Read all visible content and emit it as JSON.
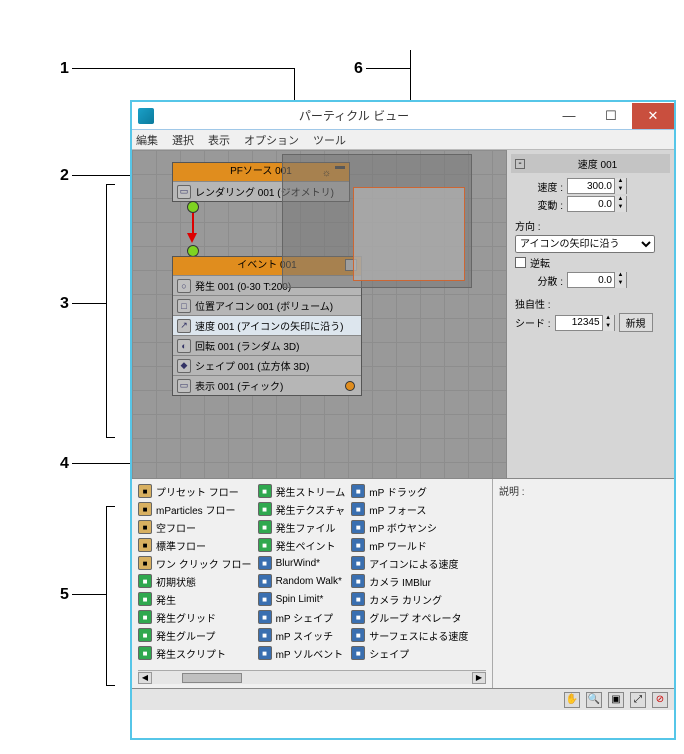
{
  "callouts": {
    "1": "1",
    "2": "2",
    "3": "3",
    "4": "4",
    "5": "5",
    "6": "6"
  },
  "window": {
    "title": "パーティクル ビュー",
    "menu": [
      "編集",
      "選択",
      "表示",
      "オプション",
      "ツール"
    ]
  },
  "pf_source": {
    "title": "PFソース 001",
    "render": "レンダリング 001 (ジオメトリ)"
  },
  "event1": {
    "title": "イベント 001",
    "ops": [
      {
        "icon": "○",
        "label": "発生 001 (0-30 T:200)"
      },
      {
        "icon": "□",
        "label": "位置アイコン 001 (ボリューム)"
      },
      {
        "icon": "↗",
        "label": "速度 001 (アイコンの矢印に沿う)"
      },
      {
        "icon": "◐",
        "label": "回転 001 (ランダム 3D)"
      },
      {
        "icon": "◆",
        "label": "シェイプ 001 (立方体 3D)"
      },
      {
        "icon": "▭",
        "label": "表示 001 (ティック)"
      }
    ]
  },
  "props": {
    "title": "速度 001",
    "speed_label": "速度 :",
    "speed": "300.0",
    "var_label": "変動 :",
    "var": "0.0",
    "dir_label": "方向 :",
    "dir_value": "アイコンの矢印に沿う",
    "rev_label": "逆転",
    "div_label": "分散 :",
    "div": "0.0",
    "uniq_label": "独自性 :",
    "seed_label": "シード :",
    "seed": "12345",
    "new_btn": "新規"
  },
  "depot": {
    "desc_label": "説明 :",
    "col1": [
      {
        "c": "di-brown",
        "t": "プリセット フロー"
      },
      {
        "c": "di-brown",
        "t": "mParticles フロー"
      },
      {
        "c": "di-brown",
        "t": "空フロー"
      },
      {
        "c": "di-brown",
        "t": "標準フロー"
      },
      {
        "c": "di-brown",
        "t": "ワン クリック フロー"
      },
      {
        "c": "di-green",
        "t": "初期状態"
      },
      {
        "c": "di-green",
        "t": "発生"
      },
      {
        "c": "di-green",
        "t": "発生グリッド"
      },
      {
        "c": "di-green",
        "t": "発生グループ"
      },
      {
        "c": "di-green",
        "t": "発生スクリプト"
      }
    ],
    "col2": [
      {
        "c": "di-green",
        "t": "発生ストリーム"
      },
      {
        "c": "di-green",
        "t": "発生テクスチャ"
      },
      {
        "c": "di-green",
        "t": "発生ファイル"
      },
      {
        "c": "di-green",
        "t": "発生ペイント"
      },
      {
        "c": "di-blue",
        "t": "BlurWind*"
      },
      {
        "c": "di-blue",
        "t": "Random Walk*"
      },
      {
        "c": "di-blue",
        "t": "Spin Limit*"
      },
      {
        "c": "di-blue",
        "t": "mP シェイプ"
      },
      {
        "c": "di-blue",
        "t": "mP スイッチ"
      },
      {
        "c": "di-blue",
        "t": "mP ソルベント"
      }
    ],
    "col3": [
      {
        "c": "di-blue",
        "t": "mP ドラッグ"
      },
      {
        "c": "di-blue",
        "t": "mP フォース"
      },
      {
        "c": "di-blue",
        "t": "mP ボウヤンシ"
      },
      {
        "c": "di-blue",
        "t": "mP ワールド"
      },
      {
        "c": "di-blue",
        "t": "アイコンによる速度"
      },
      {
        "c": "di-blue",
        "t": "カメラ IMBlur"
      },
      {
        "c": "di-blue",
        "t": "カメラ カリング"
      },
      {
        "c": "di-blue",
        "t": "グループ オペレータ"
      },
      {
        "c": "di-blue",
        "t": "サーフェスによる速度"
      },
      {
        "c": "di-blue",
        "t": "シェイプ"
      }
    ]
  }
}
